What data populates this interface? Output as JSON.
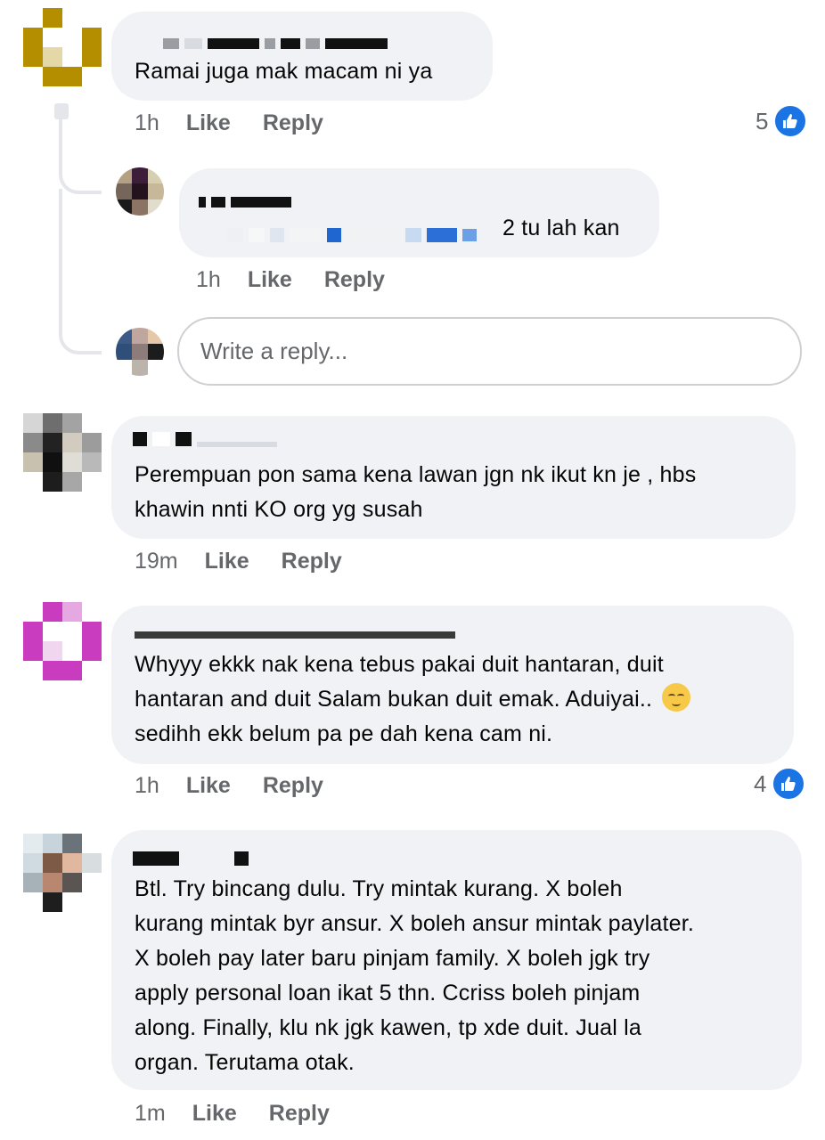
{
  "comments": [
    {
      "text_lines": [
        "Ramai juga mak macam ni ya"
      ],
      "time": "1h",
      "like_label": "Like",
      "reply_label": "Reply",
      "reaction_count": "5",
      "reaction_icon": "like-icon",
      "replies": [
        {
          "text_suffix": "2 tu lah kan",
          "time": "1h",
          "like_label": "Like",
          "reply_label": "Reply"
        }
      ],
      "reply_input": {
        "placeholder": "Write a reply..."
      }
    },
    {
      "text_lines": [
        "Perempuan pon sama kena lawan jgn nk ikut kn je , hbs",
        "khawin nnti KO org yg susah"
      ],
      "time": "19m",
      "like_label": "Like",
      "reply_label": "Reply"
    },
    {
      "text_lines": [
        "Whyyy ekkk nak kena tebus pakai duit hantaran, duit",
        "hantaran and duit Salam bukan duit emak. Aduiyai.. ",
        "sedihh ekk belum pa pe dah kena cam ni."
      ],
      "emoji": "relieved-face-emoji",
      "time": "1h",
      "like_label": "Like",
      "reply_label": "Reply",
      "reaction_count": "4",
      "reaction_icon": "like-icon"
    },
    {
      "text_lines": [
        "Btl. Try bincang dulu. Try mintak kurang. X boleh",
        "kurang mintak byr ansur. X boleh ansur mintak paylater.",
        "X boleh pay later baru pinjam family. X boleh jgk try",
        "apply personal loan ikat 5 thn. Ccriss boleh pinjam",
        "along. Finally, klu nk jgk kawen, tp xde duit. Jual la",
        "organ. Terutama otak."
      ],
      "time": "1m",
      "like_label": "Like",
      "reply_label": "Reply"
    }
  ],
  "colors": {
    "bubble": "#f0f2f5",
    "meta_text": "#65676b",
    "like_blue": "#1b74e4",
    "text": "#050505"
  }
}
